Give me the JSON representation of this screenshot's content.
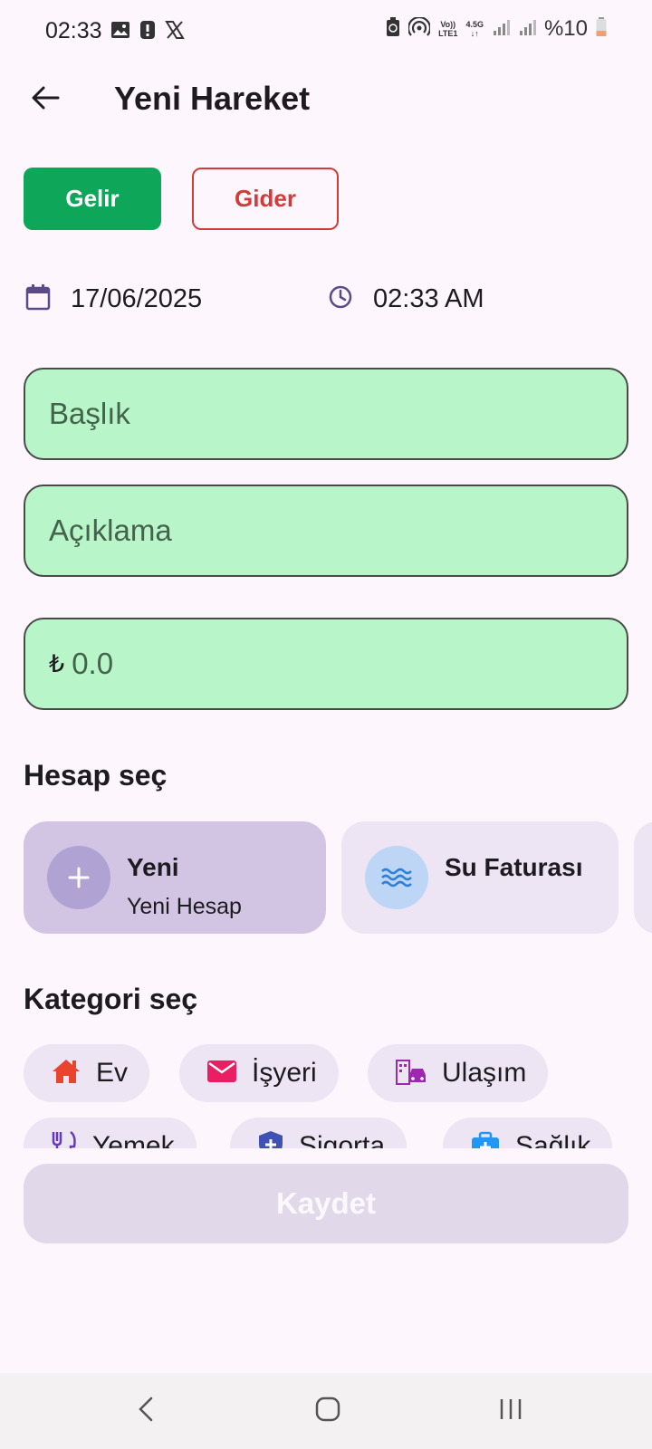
{
  "status_bar": {
    "time": "02:33",
    "volte_label_top": "Vo))",
    "volte_label_bottom": "LTE1",
    "network_type": "4.5G",
    "battery": "%10",
    "icons": [
      "gallery-icon",
      "alert-icon",
      "x-icon",
      "battery-saver-icon",
      "hotspot-icon",
      "signal-icon",
      "battery-icon"
    ]
  },
  "app_bar": {
    "title": "Yeni Hareket",
    "back_icon": "arrow-left-icon"
  },
  "type_toggle": {
    "income_label": "Gelir",
    "expense_label": "Gider",
    "income_color": "#0ea75a",
    "expense_color": "#d33b3b"
  },
  "datetime": {
    "date": "17/06/2025",
    "time": "02:33 AM",
    "date_icon": "calendar-icon",
    "time_icon": "clock-icon"
  },
  "form": {
    "title_placeholder": "Başlık",
    "description_placeholder": "Açıklama",
    "currency_symbol": "₺",
    "amount_placeholder": "0.0",
    "field_color": "#b8f5c8"
  },
  "accounts_section": {
    "title": "Hesap seç",
    "items": [
      {
        "name": "Yeni",
        "subtitle": "Yeni Hesap",
        "icon": "plus-icon",
        "selected": true
      },
      {
        "name": "Su Faturası",
        "subtitle": "",
        "icon": "water-icon",
        "selected": false
      }
    ]
  },
  "categories_section": {
    "title": "Kategori seç",
    "items": [
      {
        "label": "Ev",
        "icon": "home-icon",
        "color": "#e8442e"
      },
      {
        "label": "İşyeri",
        "icon": "mail-icon",
        "color": "#e91e63"
      },
      {
        "label": "Ulaşım",
        "icon": "city-transport-icon",
        "color": "#9c27b0"
      },
      {
        "label": "Yemek",
        "icon": "restaurant-icon",
        "color": "#673ab7"
      },
      {
        "label": "Sigorta",
        "icon": "shield-plus-icon",
        "color": "#3f51b5"
      },
      {
        "label": "Sağlık",
        "icon": "medical-bag-icon",
        "color": "#2196f3"
      }
    ]
  },
  "save_button": {
    "label": "Kaydet"
  },
  "nav_bar": {
    "icons": [
      "nav-back-icon",
      "nav-home-icon",
      "nav-recents-icon"
    ]
  }
}
